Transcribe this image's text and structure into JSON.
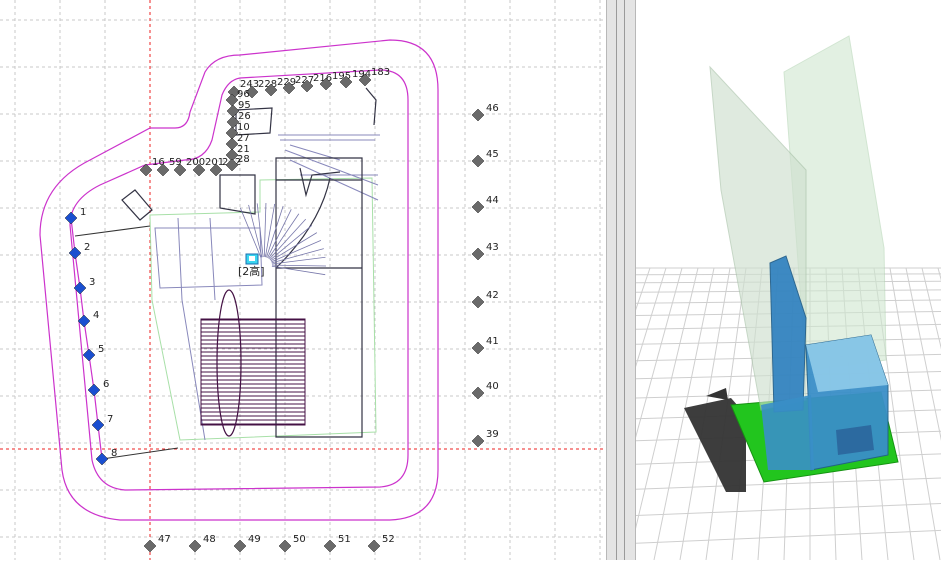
{
  "plan": {
    "left_points": [
      "1",
      "2",
      "3",
      "4",
      "5",
      "6",
      "7",
      "8"
    ],
    "right_points": [
      "46",
      "45",
      "44",
      "43",
      "42",
      "41",
      "40",
      "39"
    ],
    "bottom_points": [
      "47",
      "48",
      "49",
      "50",
      "51",
      "52"
    ],
    "top_labels": [
      "16",
      "59",
      "200",
      "201",
      "212",
      "243",
      "228",
      "229",
      "227",
      "216",
      "195",
      "194",
      "183"
    ],
    "inner_labels": [
      "96",
      "95",
      "26",
      "10",
      "27",
      "21",
      "28"
    ],
    "marker_label": "[2高]",
    "colors": {
      "boundary": "#cc33cc",
      "grid": "#c8c8c8",
      "axis": "#ee2222",
      "marker_blue": "#1a4fd0",
      "marker_gray": "#6a6a6a"
    }
  },
  "view3d": {
    "colors": {
      "floor_grid": "#cfcfcf",
      "base_green": "#22c51e",
      "building_blue": "#3a8fc8",
      "glass_green": "#cfe7cf",
      "shadow": "#333333"
    }
  }
}
